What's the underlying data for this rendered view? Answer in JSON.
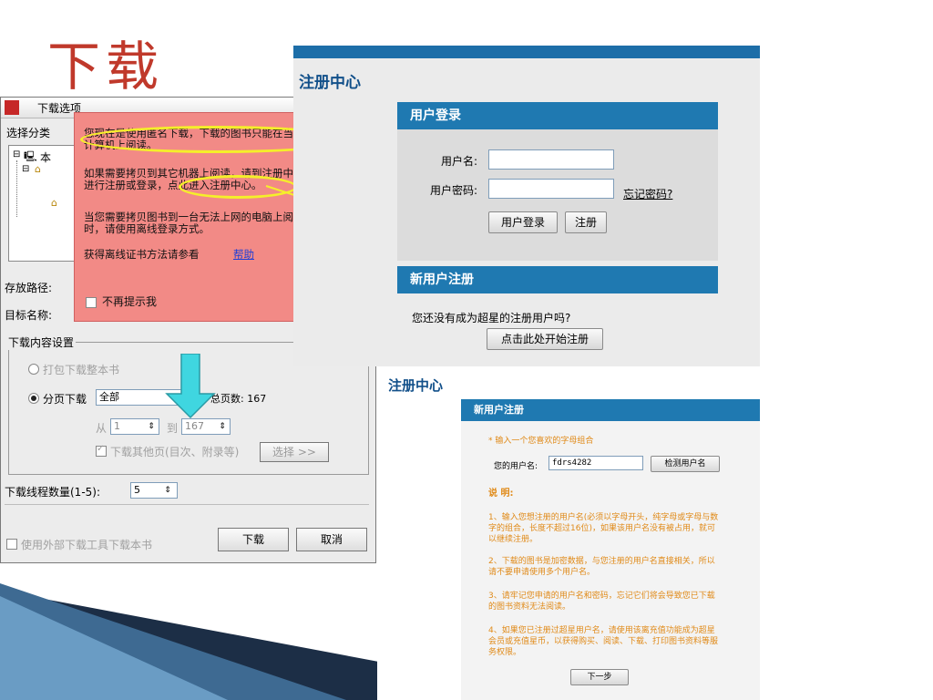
{
  "slide": {
    "title": "下载"
  },
  "dialog": {
    "title": "下载选项",
    "category_label": "选择分类",
    "tree_root_label": "本",
    "save_path_label": "存放路径:",
    "target_name_label": "目标名称:",
    "content_settings_label": "下载内容设置",
    "pack_whole_book_label": "打包下载整本书",
    "page_download_label": "分页下载",
    "page_download_value": "全部",
    "total_pages_label": "总页数: 167",
    "from_label": "从",
    "from_value": "1",
    "to_label": "到",
    "to_value": "167",
    "other_pages_label": "下载其他页(目次、附录等)",
    "select_button": "选择 >>",
    "threads_label": "下载线程数量(1-5):",
    "threads_value": "5",
    "external_tool_label": "使用外部下载工具下载本书",
    "download_button": "下载",
    "cancel_button": "取消",
    "popup": {
      "line1a": "您现在是使用匿名下载，下载的图书只能在当前",
      "line1b": "计算机上阅读。",
      "line2a": "如果需要拷贝到其它机器上阅读，请到注册中心",
      "line2b": "进行注册或登录，点此进入注册中心。",
      "line3a": "当您需要拷贝图书到一台无法上网的电脑上阅读",
      "line3b": "时，请使用离线登录方式。",
      "line4": "获得离线证书方法请参看",
      "help_link": "帮助",
      "no_more_label": "不再提示我",
      "collapse_icon": "double-chevron-up"
    }
  },
  "login_panel": {
    "heading": "注册中心",
    "login_section_title": "用户登录",
    "username_label": "用户名:",
    "password_label": "用户密码:",
    "forgot_password": "忘记密码?",
    "login_button": "用户登录",
    "register_button": "注册",
    "new_user_section_title": "新用户注册",
    "not_registered_text": "您还没有成为超星的注册用户吗?",
    "start_register_button": "点击此处开始注册"
  },
  "register_panel": {
    "heading": "注册中心",
    "section_title": "新用户注册",
    "hint": "* 输入一个您喜欢的字母组合",
    "username_label": "您的用户名:",
    "username_value": "fdrs4282",
    "check_button": "检测用户名",
    "notes_title": "说 明:",
    "note1a": "1、输入您想注册的用户名(必须以字母开头，纯字母或字母与数",
    "note1b": "字的组合，长度不超过16位)，如果该用户名没有被占用，就可",
    "note1c": "以继续注册。",
    "note2a": "2、下载的图书是加密数据，与您注册的用户名直接相关，所以",
    "note2b": "请不要申请使用多个用户名。",
    "note3a": "3、请牢记您申请的用户名和密码，忘记它们将会导致您已下载",
    "note3b": "的图书资料无法阅读。",
    "note4a": "4、如果您已注册过超星用户名，请使用该离充值功能成为超星",
    "note4b": "会员或充值星币，以获得购买、阅读、下载、打印图书资料等服",
    "note4c": "务权限。",
    "next_button": "下一步"
  },
  "colors": {
    "title_red": "#c0392b",
    "popup_red": "#f28a86",
    "highlight_yellow": "#f5ef2a",
    "panel_blue": "#1f79b1",
    "arrow_cyan": "#3fd6e0",
    "note_orange": "#e08a18"
  }
}
